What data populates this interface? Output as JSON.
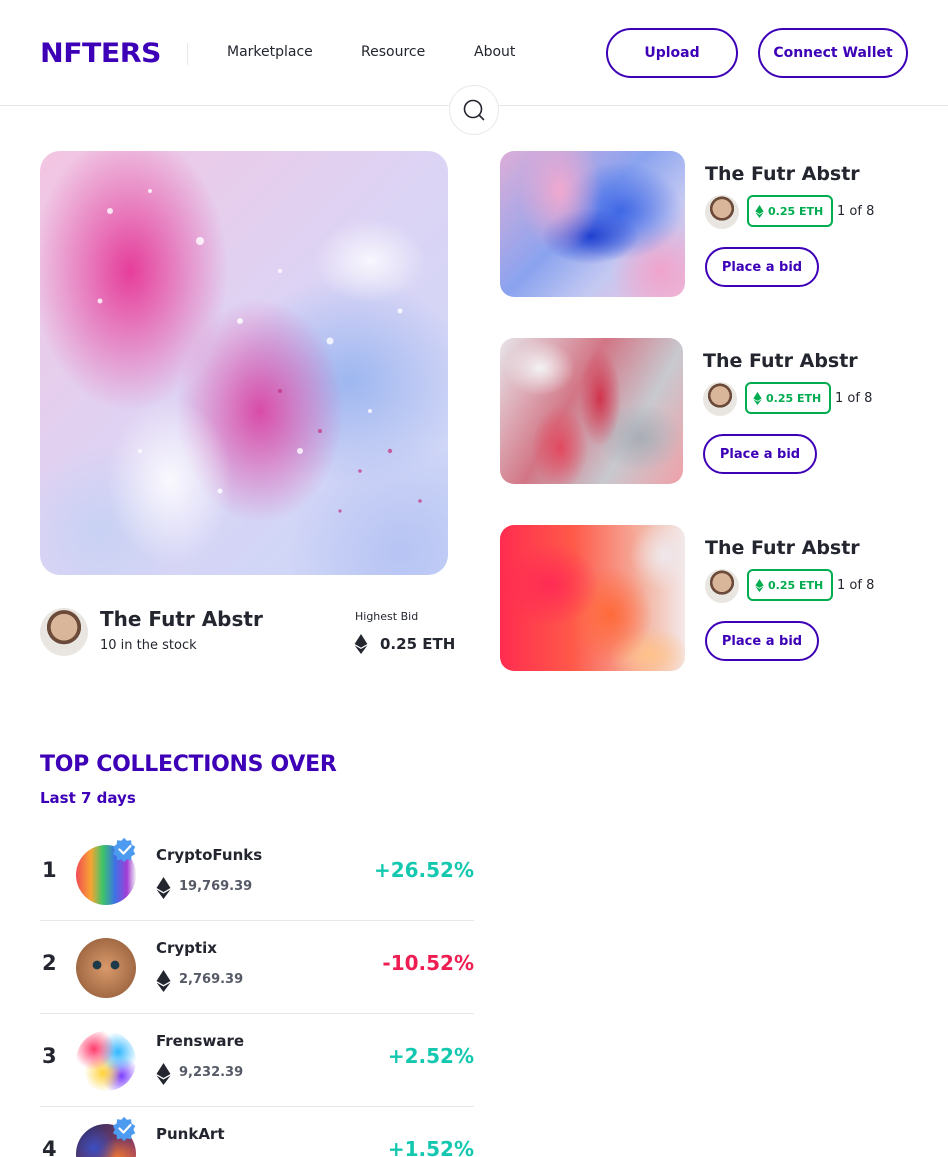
{
  "header": {
    "logo": "NFTERS",
    "nav": [
      "Marketplace",
      "Resource",
      "About"
    ],
    "upload_label": "Upload",
    "connect_label": "Connect Wallet"
  },
  "hero": {
    "title": "The Futr Abstr",
    "stock": "10 in the stock",
    "bid_label": "Highest Bid",
    "bid_value": "0.25 ETH"
  },
  "side_cards": [
    {
      "title": "The Futr Abstr",
      "price": "0.25 ETH",
      "count": "1 of 8",
      "button": "Place a bid"
    },
    {
      "title": "The Futr Abstr",
      "price": "0.25 ETH",
      "count": "1 of 8",
      "button": "Place a bid"
    },
    {
      "title": "The Futr Abstr",
      "price": "0.25 ETH",
      "count": "1 of 8",
      "button": "Place a bid"
    }
  ],
  "collections": {
    "title": "TOP COLLECTIONS OVER",
    "subtitle": "Last 7 days",
    "items": [
      {
        "rank": "1",
        "name": "CryptoFunks",
        "value": "19,769.39",
        "change": "+26.52%",
        "verified": true
      },
      {
        "rank": "2",
        "name": "Cryptix",
        "value": "2,769.39",
        "change": "-10.52%",
        "verified": false
      },
      {
        "rank": "3",
        "name": "Frensware",
        "value": "9,232.39",
        "change": "+2.52%",
        "verified": false
      },
      {
        "rank": "4",
        "name": "PunkArt",
        "value": "",
        "change": "+1.52%",
        "verified": true
      }
    ]
  },
  "colors": {
    "brand": "#3d00b7",
    "positive": "#14c8b0",
    "negative": "#ee1d52",
    "eth_green": "#00ac4f"
  }
}
